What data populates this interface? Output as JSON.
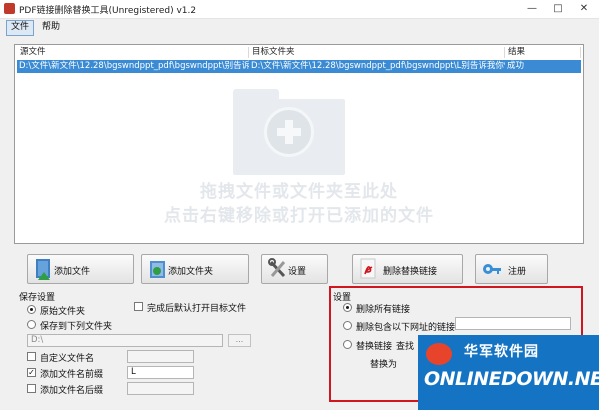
{
  "window": {
    "title": "PDF链接删除替换工具(Unregistered) v1.2",
    "controls": [
      "—",
      "□",
      "✕"
    ]
  },
  "menu": [
    "文件",
    "帮助"
  ],
  "file_table": {
    "headers": [
      "源文件",
      "目标文件夹",
      "结果"
    ],
    "rows": [
      [
        "D:\\文件\\新文件\\12.28\\bgswndppt_pdf\\bgswndppt\\别告诉...",
        "D:\\文件\\新文件\\12.28\\bgswndppt_pdf\\bgswndppt\\L别告诉我你懂PP...",
        "成功"
      ]
    ],
    "drop_hint_1": "拖拽文件或文件夹至此处",
    "drop_hint_2": "点击右键移除或打开已添加的文件"
  },
  "buttons": {
    "add_file": "添加文件",
    "add_folder": "添加文件夹",
    "settings": "设置",
    "delete_replace": "删除替换链接",
    "register": "注册"
  },
  "save_settings": {
    "group_label": "保存设置",
    "radio_original": "原始文件夹",
    "radio_save_to": "保存到下列文件夹",
    "open_after": "完成后默认打开目标文件",
    "path_value": "D:\\",
    "browse": "...",
    "custom_filename": "自定义文件名",
    "add_prefix": "添加文件名前缀",
    "prefix_value": "L",
    "add_suffix": "添加文件名后缀"
  },
  "settings_panel": {
    "group_label": "设置",
    "delete_all": "删除所有链接",
    "delete_containing": "删除包含以下网址的链接",
    "replace_link": "替换链接",
    "find": "查找",
    "replace_with": "替换为"
  },
  "watermark": {
    "cn": "华军软件园",
    "en": "ONLINEDOWN.NET"
  },
  "colors": {
    "selection": "#3b8bd4",
    "highlight_box": "#d0161e",
    "watermark_bg": "#1573c3"
  }
}
